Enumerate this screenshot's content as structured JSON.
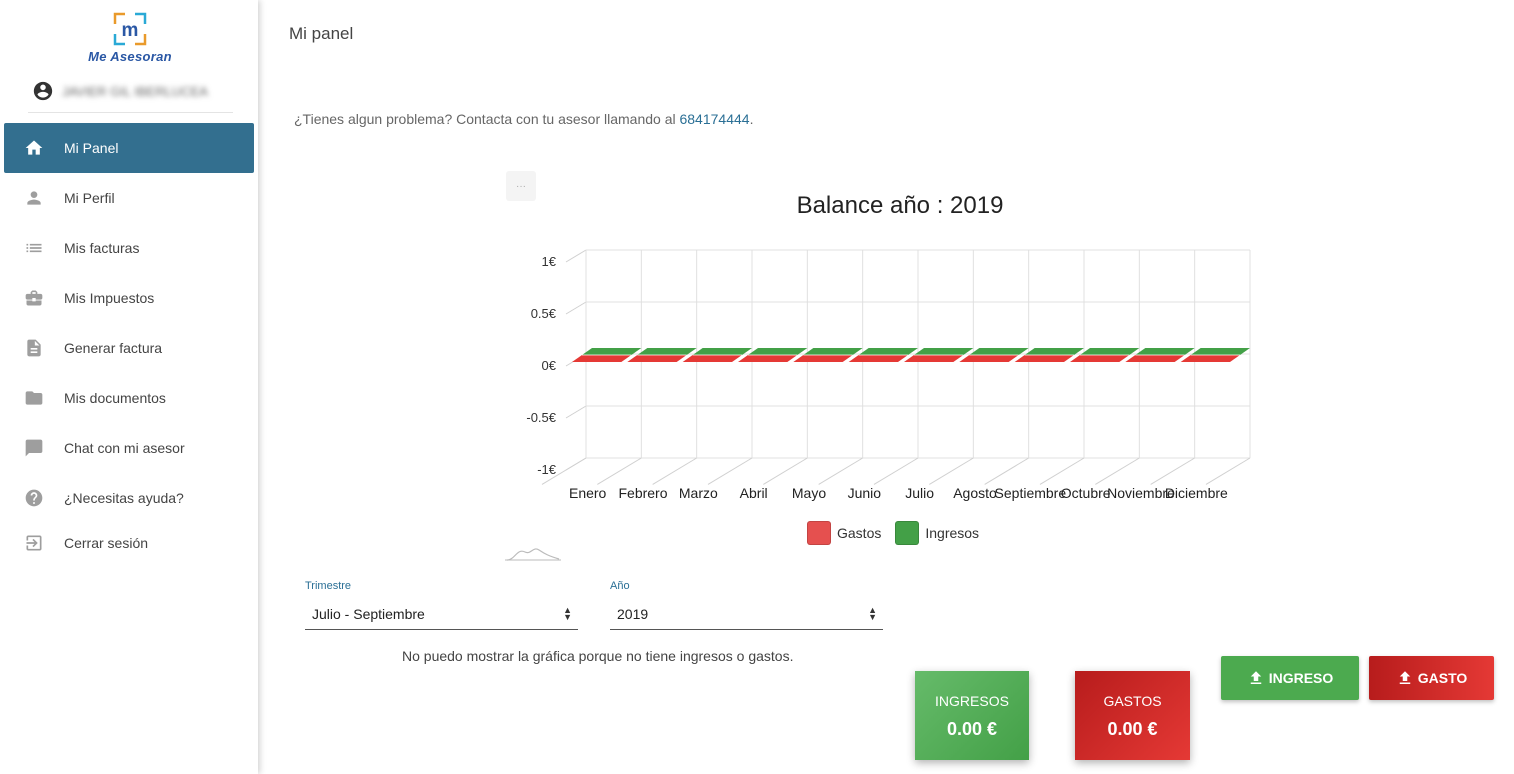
{
  "brand": {
    "name": "Me Asesoran",
    "logo_letter": "m"
  },
  "user": {
    "name": "JAVIER GIL IBERLUCEA"
  },
  "sidebar": {
    "items": [
      {
        "label": "Mi Panel",
        "icon": "home-icon",
        "active": true
      },
      {
        "label": "Mi Perfil",
        "icon": "person-icon"
      },
      {
        "label": "Mis facturas",
        "icon": "list-icon"
      },
      {
        "label": "Mis Impuestos",
        "icon": "briefcase-icon"
      },
      {
        "label": "Generar factura",
        "icon": "document-icon"
      },
      {
        "label": "Mis documentos",
        "icon": "folder-icon"
      },
      {
        "label": "Chat con mi asesor",
        "icon": "chat-icon"
      },
      {
        "label": "¿Necesitas ayuda?",
        "icon": "help-icon"
      },
      {
        "label": "Cerrar sesión",
        "icon": "logout-icon"
      }
    ]
  },
  "main": {
    "page_title": "Mi panel",
    "help_text": "¿Tienes algun problema? Contacta con tu asesor llamando al ",
    "help_phone": "684174444",
    "help_suffix": ".",
    "chart_menu_label": "···",
    "no_chart_message": "No puedo mostrar la gráfica porque no tiene ingresos o gastos."
  },
  "filters": {
    "trimestre": {
      "label": "Trimestre",
      "value": "Julio - Septiembre"
    },
    "anio": {
      "label": "Año",
      "value": "2019"
    }
  },
  "actions": {
    "ingreso_label": "INGRESO",
    "gasto_label": "GASTO"
  },
  "summary": {
    "ingresos": {
      "title": "INGRESOS",
      "value": "0.00 €"
    },
    "gastos": {
      "title": "GASTOS",
      "value": "0.00 €"
    }
  },
  "colors": {
    "primary": "#336f8f",
    "gastos": "#e53935",
    "ingresos": "#43a047"
  },
  "chart_data": {
    "type": "bar",
    "title": "Balance año : 2019",
    "categories": [
      "Enero",
      "Febrero",
      "Marzo",
      "Abril",
      "Mayo",
      "Junio",
      "Julio",
      "Agosto",
      "Septiembre",
      "Octubre",
      "Noviembre",
      "Diciembre"
    ],
    "series": [
      {
        "name": "Gastos",
        "values": [
          0,
          0,
          0,
          0,
          0,
          0,
          0,
          0,
          0,
          0,
          0,
          0
        ],
        "color": "#e53935"
      },
      {
        "name": "Ingresos",
        "values": [
          0,
          0,
          0,
          0,
          0,
          0,
          0,
          0,
          0,
          0,
          0,
          0
        ],
        "color": "#43a047"
      }
    ],
    "yticks": [
      "1€",
      "0.5€",
      "0€",
      "-0.5€",
      "-1€"
    ],
    "ylim": [
      -1,
      1
    ],
    "grid": true,
    "legend": "bottom",
    "style": "3d"
  }
}
